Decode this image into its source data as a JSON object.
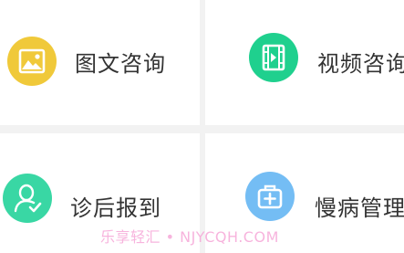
{
  "menu": {
    "items": [
      {
        "label": "图文咨询",
        "icon": "image-icon",
        "color": "#f0c93a"
      },
      {
        "label": "视频咨询",
        "icon": "video-film-icon",
        "color": "#1fd08e"
      },
      {
        "label": "诊后报到",
        "icon": "patient-check-icon",
        "color": "#39d7a4"
      },
      {
        "label": "慢病管理",
        "icon": "medical-kit-icon",
        "color": "#74bdf4"
      }
    ]
  },
  "watermark": "乐享轻汇 • NJYCQH.COM"
}
